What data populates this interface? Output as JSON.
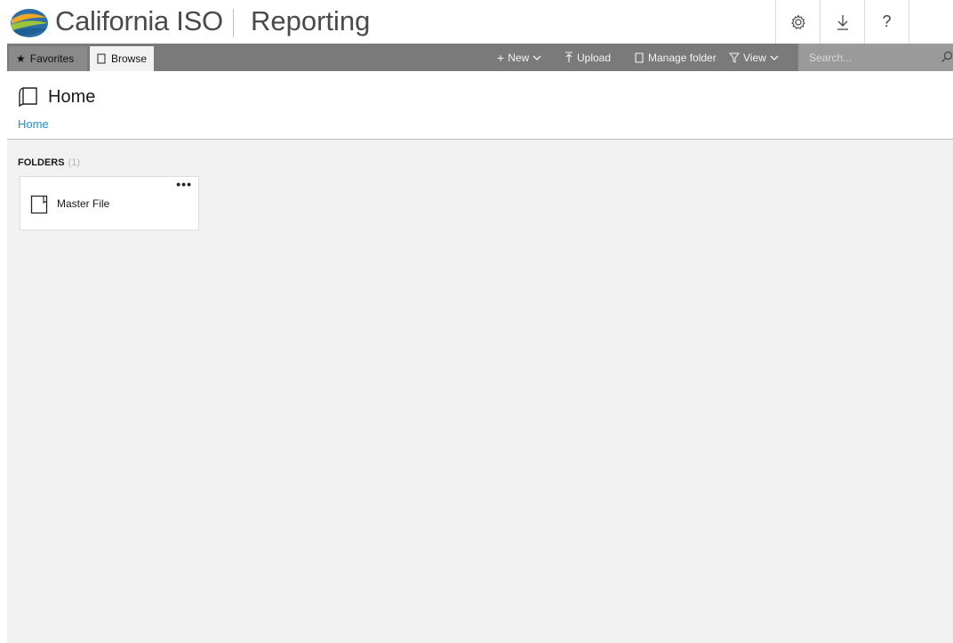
{
  "header": {
    "brand": "California ISO",
    "app_name": "Reporting",
    "settings_icon": "gear-icon",
    "download_icon": "download-icon",
    "help_label": "?"
  },
  "toolbar": {
    "tabs": [
      {
        "label": "Favorites",
        "icon": "star-icon"
      },
      {
        "label": "Browse",
        "icon": "page-icon"
      }
    ],
    "new_label": "New",
    "upload_label": "Upload",
    "manage_label": "Manage folder",
    "view_label": "View",
    "search_placeholder": "Search..."
  },
  "page": {
    "title": "Home",
    "breadcrumb": "Home"
  },
  "content": {
    "section_label": "FOLDERS",
    "section_count": "(1)",
    "folders": [
      {
        "name": "Master File"
      }
    ]
  },
  "colors": {
    "toolbar_bg": "#7a7a7a",
    "link": "#1e8fd6",
    "content_bg": "#f1f1f1"
  }
}
